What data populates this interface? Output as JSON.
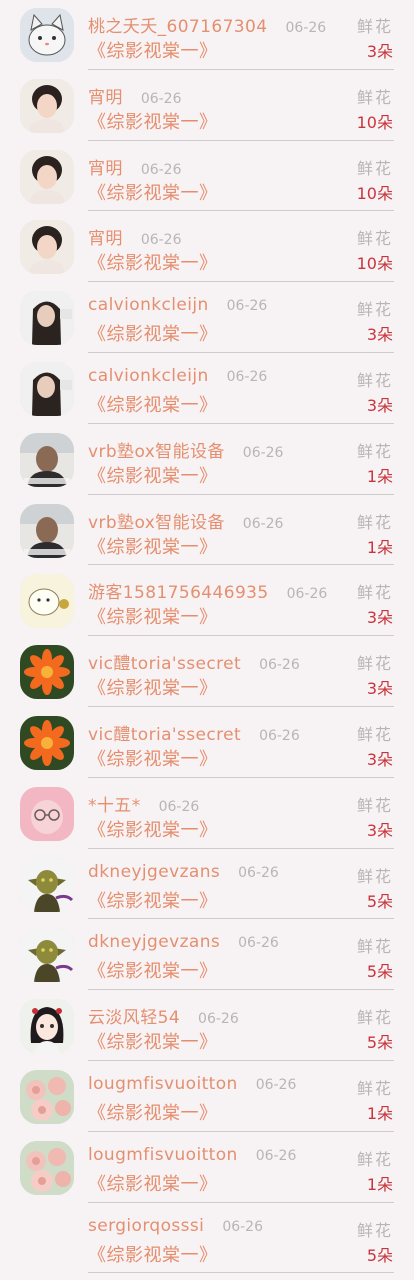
{
  "gift_records": [
    {
      "avatar": "cat-cartoon",
      "name": "桃之夭夭_607167304",
      "date": "06-26",
      "title": "《综影视棠一》",
      "gift_label": "鲜花",
      "gift_count": "3朵"
    },
    {
      "avatar": "man-portrait",
      "name": "宵明",
      "date": "06-26",
      "title": "《综影视棠一》",
      "gift_label": "鲜花",
      "gift_count": "10朵"
    },
    {
      "avatar": "man-portrait",
      "name": "宵明",
      "date": "06-26",
      "title": "《综影视棠一》",
      "gift_label": "鲜花",
      "gift_count": "10朵"
    },
    {
      "avatar": "man-portrait",
      "name": "宵明",
      "date": "06-26",
      "title": "《综影视棠一》",
      "gift_label": "鲜花",
      "gift_count": "10朵"
    },
    {
      "avatar": "woman-dark-hair",
      "name": "calvionkcleijn",
      "date": "06-26",
      "title": "《综影视棠一》",
      "gift_label": "鲜花",
      "gift_count": "3朵"
    },
    {
      "avatar": "woman-dark-hair",
      "name": "calvionkcleijn",
      "date": "06-26",
      "title": "《综影视棠一》",
      "gift_label": "鲜花",
      "gift_count": "3朵"
    },
    {
      "avatar": "man-office",
      "name": "vrb塾ox智能设备",
      "date": "06-26",
      "title": "《综影视棠一》",
      "gift_label": "鲜花",
      "gift_count": "1朵"
    },
    {
      "avatar": "man-office",
      "name": "vrb塾ox智能设备",
      "date": "06-26",
      "title": "《综影视棠一》",
      "gift_label": "鲜花",
      "gift_count": "1朵"
    },
    {
      "avatar": "hamster-cartoon",
      "name": "游客1581756446935",
      "date": "06-26",
      "title": "《综影视棠一》",
      "gift_label": "鲜花",
      "gift_count": "3朵"
    },
    {
      "avatar": "orange-flower",
      "name": "vic醴toria'ssecret",
      "date": "06-26",
      "title": "《综影视棠一》",
      "gift_label": "鲜花",
      "gift_count": "3朵"
    },
    {
      "avatar": "orange-flower",
      "name": "vic醴toria'ssecret",
      "date": "06-26",
      "title": "《综影视棠一》",
      "gift_label": "鲜花",
      "gift_count": "3朵"
    },
    {
      "avatar": "pink-glasses-girl",
      "name": "*十五*",
      "date": "06-26",
      "title": "《综影视棠一》",
      "gift_label": "鲜花",
      "gift_count": "3朵"
    },
    {
      "avatar": "goblin-character",
      "name": "dkneyjgevzans",
      "date": "06-26",
      "title": "《综影视棠一》",
      "gift_label": "鲜花",
      "gift_count": "5朵"
    },
    {
      "avatar": "goblin-character",
      "name": "dkneyjgevzans",
      "date": "06-26",
      "title": "《综影视棠一》",
      "gift_label": "鲜花",
      "gift_count": "5朵"
    },
    {
      "avatar": "anime-girl",
      "name": "云淡风轻54",
      "date": "06-26",
      "title": "《综影视棠一》",
      "gift_label": "鲜花",
      "gift_count": "5朵"
    },
    {
      "avatar": "pink-roses",
      "name": "lougmfisvuoitton",
      "date": "06-26",
      "title": "《综影视棠一》",
      "gift_label": "鲜花",
      "gift_count": "1朵"
    },
    {
      "avatar": "pink-roses",
      "name": "lougmfisvuoitton",
      "date": "06-26",
      "title": "《综影视棠一》",
      "gift_label": "鲜花",
      "gift_count": "1朵"
    },
    {
      "avatar": "none",
      "name": "sergiorqosssi",
      "date": "06-26",
      "title": "《综影视棠一》",
      "gift_label": "鲜花",
      "gift_count": "5朵"
    }
  ],
  "colors": {
    "name": "#e48f70",
    "title": "#e68d6d",
    "muted": "#b9b4b6",
    "count": "#c8353d",
    "background": "#f7f3f4"
  }
}
